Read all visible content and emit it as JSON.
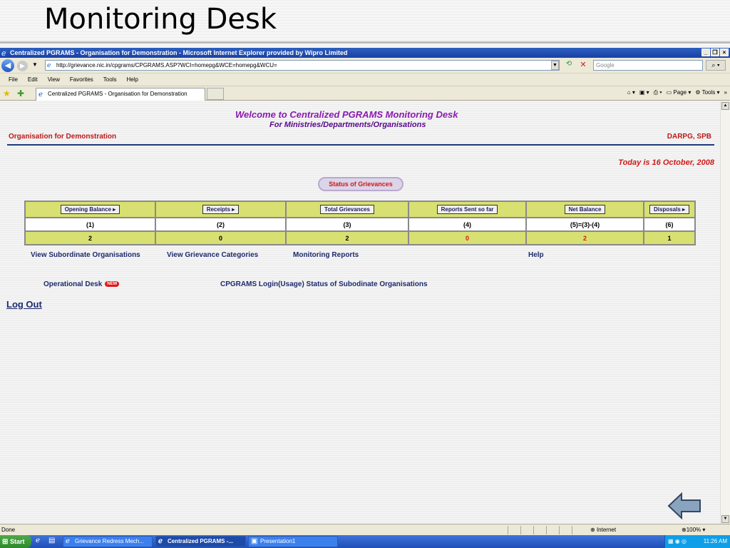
{
  "slide": {
    "title": "Monitoring Desk"
  },
  "browser": {
    "window_title": "Centralized PGRAMS - Organisation for Demonstration - Microsoft Internet Explorer provided by Wipro Limited",
    "address": "http://grievance.nic.in/cpgrams/CPGRAMS.ASP?WCI=homepg&WCE=homepg&WCU=",
    "search_placeholder": "Google",
    "menu": [
      "File",
      "Edit",
      "View",
      "Favorites",
      "Tools",
      "Help"
    ],
    "tab_title": "Centralized PGRAMS - Organisation for Demonstration",
    "commands": {
      "page": "Page",
      "tools": "Tools"
    },
    "status_text": "Done",
    "zone": "Internet",
    "zoom": "100%"
  },
  "page": {
    "welcome": "Welcome to Centralized PGRAMS Monitoring Desk",
    "sub_welcome": "For Ministries/Departments/Organisations",
    "org_name": "Organisation for Demonstration",
    "org_code": "DARPG, SPB",
    "today": "Today is 16 October, 2008",
    "status_button": "Status of Grievances",
    "table": {
      "headers": [
        "Opening Balance",
        "Receipts",
        "Total Grievances",
        "Reports Sent so far",
        "Net Balance",
        "Disposals"
      ],
      "numbers": [
        "(1)",
        "(2)",
        "(3)",
        "(4)",
        "(5)=(3)-(4)",
        "(6)"
      ],
      "values": [
        "2",
        "0",
        "2",
        "0",
        "2",
        "1"
      ]
    },
    "links": {
      "subordinate": "View Subordinate Organisations",
      "categories": "View Grievance Categories",
      "reports": "Monitoring Reports",
      "help": "Help",
      "operational": "Operational Desk",
      "new_badge": "NEW",
      "login_status": "CPGRAMS Login(Usage) Status of Subodinate Organisations",
      "logout": "Log Out"
    }
  },
  "taskbar": {
    "start": "Start",
    "tasks": [
      "Grievance Redress Mech...",
      "Centralized PGRAMS -...",
      "Presentation1"
    ],
    "clock": "11:26 AM"
  },
  "colors": {
    "accent_purple": "#8a1ab0",
    "alert_red": "#d41818",
    "table_green": "#d8e072",
    "link_navy": "#1c2a6e"
  }
}
